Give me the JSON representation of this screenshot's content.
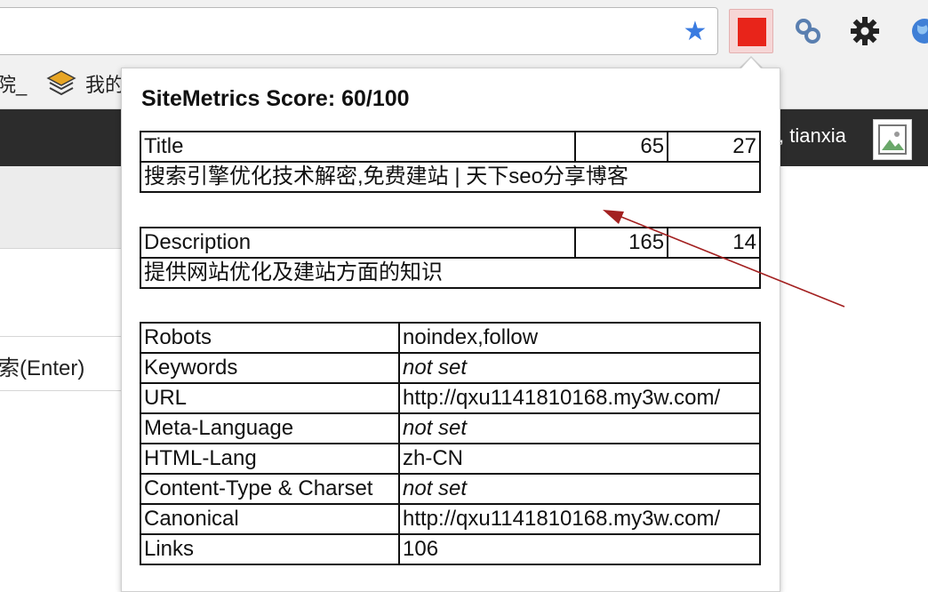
{
  "toolbar": {
    "star_icon": "bookmark-star-icon",
    "extension_color": "#e8241a",
    "icons": [
      "chain-link-icon",
      "gear-icon",
      "globe-icon"
    ]
  },
  "bookmarks": {
    "left_text": "院_",
    "item_label": "我的"
  },
  "header": {
    "username": ", tianxia"
  },
  "page": {
    "search_label": "索(Enter)"
  },
  "popup": {
    "score_title": "SiteMetrics Score: 60/100",
    "title_block": {
      "label": "Title",
      "value1": "65",
      "value2": "27",
      "text": "搜索引擎优化技术解密,免费建站 | 天下seo分享博客"
    },
    "description_block": {
      "label": "Description",
      "value1": "165",
      "value2": "14",
      "text": "提供网站优化及建站方面的知识"
    },
    "rows": [
      {
        "label": "Robots",
        "value": "noindex,follow"
      },
      {
        "label": "Keywords",
        "value": "not set"
      },
      {
        "label": "URL",
        "value": "http://qxu1141810168.my3w.com/"
      },
      {
        "label": "Meta-Language",
        "value": "not set"
      },
      {
        "label": "HTML-Lang",
        "value": "zh-CN"
      },
      {
        "label": "Content-Type & Charset",
        "value": "not set"
      },
      {
        "label": "Canonical",
        "value": "http://qxu1141810168.my3w.com/"
      },
      {
        "label": "Links",
        "value": "106"
      }
    ]
  }
}
